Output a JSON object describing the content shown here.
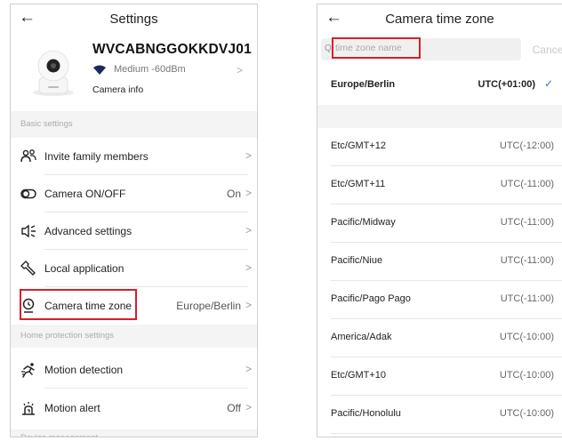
{
  "settings": {
    "title": "Settings",
    "device_name": "WVCABNGGOKKDVJ01",
    "signal": "Medium -60dBm",
    "camera_info": "Camera info",
    "section_basic": "Basic settings",
    "section_home": "Home protection settings",
    "section_device": "Device management",
    "rows": [
      {
        "label": "Invite family members",
        "value": "",
        "icon": "family-icon"
      },
      {
        "label": "Camera ON/OFF",
        "value": "On",
        "icon": "toggle-icon"
      },
      {
        "label": "Advanced settings",
        "value": "",
        "icon": "speaker-icon"
      },
      {
        "label": "Local application",
        "value": "",
        "icon": "wrench-icon"
      },
      {
        "label": "Camera time zone",
        "value": "Europe/Berlin",
        "icon": "location-pin-icon"
      },
      {
        "label": "Motion detection",
        "value": "",
        "icon": "running-icon"
      },
      {
        "label": "Motion alert",
        "value": "Off",
        "icon": "alert-bell-icon"
      }
    ]
  },
  "timezone": {
    "title": "Camera time zone",
    "search_placeholder": "time zone name",
    "cancel": "Cancel",
    "selected": {
      "name": "Europe/Berlin",
      "offset": "UTC(+01:00)"
    },
    "zones": [
      {
        "name": "Etc/GMT+12",
        "offset": "UTC(-12:00)"
      },
      {
        "name": "Etc/GMT+11",
        "offset": "UTC(-11:00)"
      },
      {
        "name": "Pacific/Midway",
        "offset": "UTC(-11:00)"
      },
      {
        "name": "Pacific/Niue",
        "offset": "UTC(-11:00)"
      },
      {
        "name": "Pacific/Pago Pago",
        "offset": "UTC(-11:00)"
      },
      {
        "name": "America/Adak",
        "offset": "UTC(-10:00)"
      },
      {
        "name": "Etc/GMT+10",
        "offset": "UTC(-10:00)"
      },
      {
        "name": "Pacific/Honolulu",
        "offset": "UTC(-10:00)"
      }
    ]
  },
  "colors": {
    "highlight": "#d62028",
    "check": "#3d6fd6"
  }
}
